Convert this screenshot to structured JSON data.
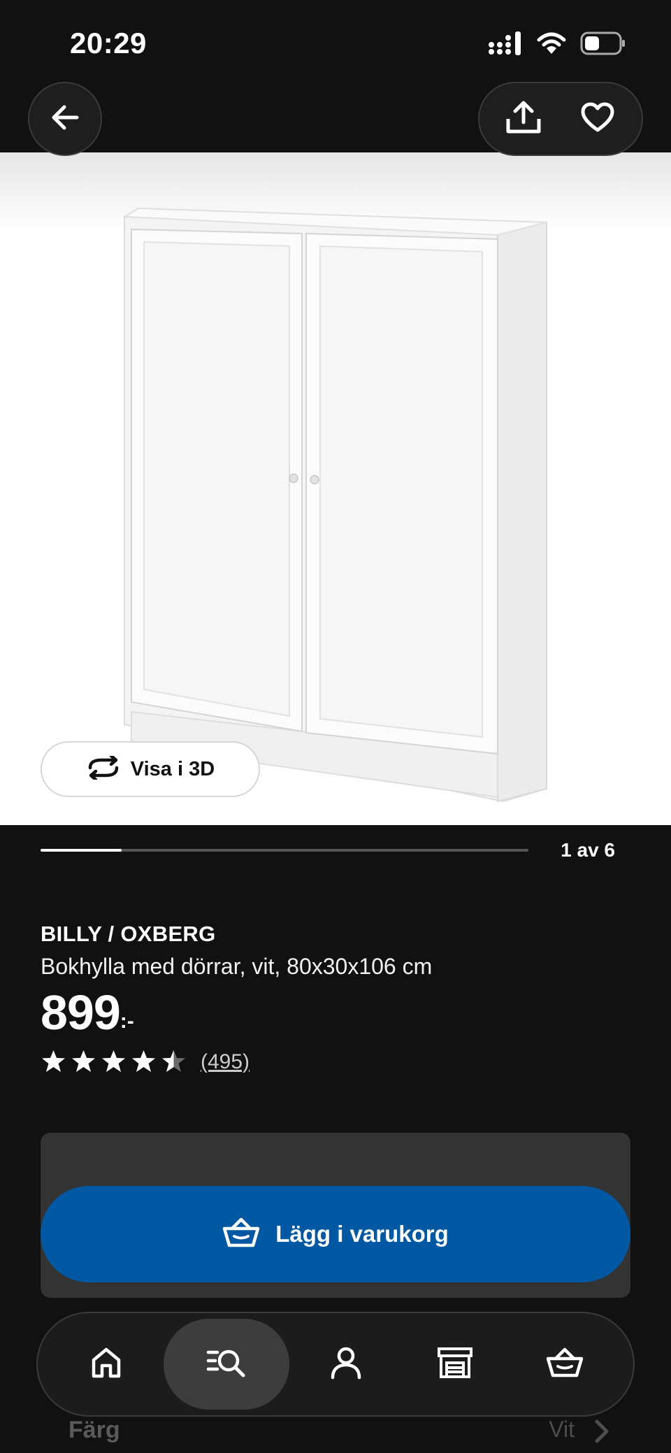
{
  "status_bar": {
    "time": "20:29",
    "icons": [
      "signal-icon",
      "wifi-icon",
      "battery-icon"
    ]
  },
  "header": {
    "back_icon": "arrow-left-icon",
    "share_icon": "share-icon",
    "favorite_icon": "heart-icon"
  },
  "gallery": {
    "view3d_label": "Visa i 3D",
    "view3d_icon": "rotate-icon",
    "position_text": "1 av 6",
    "current": 1,
    "total": 6
  },
  "product": {
    "name": "BILLY / OXBERG",
    "description": "Bokhylla med dörrar, vit, 80x30x106 cm",
    "price": "899",
    "price_suffix": ":-",
    "rating": 4.5,
    "rating_max": 5,
    "review_count": "(495)"
  },
  "cart": {
    "add_label": "Lägg i varukorg",
    "add_icon": "basket-icon",
    "button_color": "#0058a3"
  },
  "details": {
    "color_label": "Färg",
    "color_value": "Vit"
  },
  "bottom_nav": {
    "items": [
      {
        "icon": "home-icon",
        "active": false
      },
      {
        "icon": "search-list-icon",
        "active": true
      },
      {
        "icon": "profile-icon",
        "active": false
      },
      {
        "icon": "store-icon",
        "active": false
      },
      {
        "icon": "basket-icon",
        "active": false
      }
    ]
  }
}
